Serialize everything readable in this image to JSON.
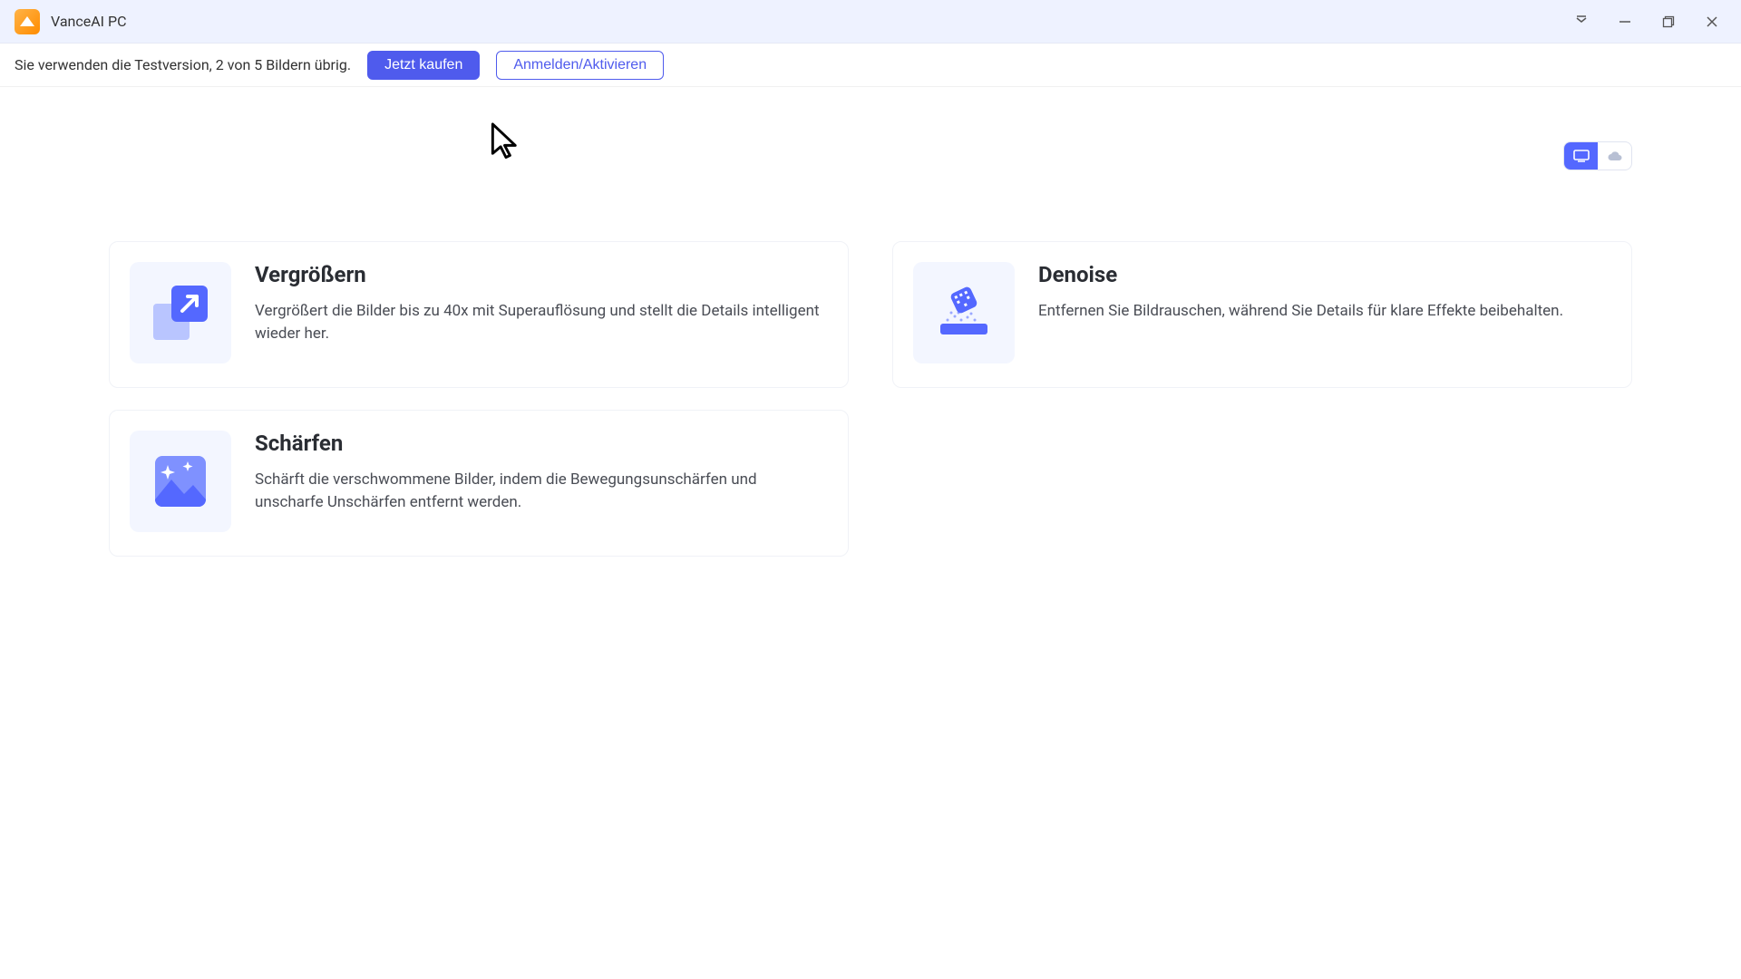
{
  "window": {
    "title": "VanceAI PC"
  },
  "trial": {
    "message": "Sie verwenden die Testversion, 2 von 5 Bildern übrig.",
    "buy_label": "Jetzt kaufen",
    "login_label": "Anmelden/Aktivieren"
  },
  "mode_toggle": {
    "local_icon": "monitor-icon",
    "cloud_icon": "cloud-icon",
    "active": "local"
  },
  "cards": [
    {
      "key": "enlarge",
      "title": "Vergrößern",
      "desc": "Vergrößert die Bilder bis zu 40x mit Superauflösung und stellt die Details intelligent wieder her.",
      "icon": "enlarge-icon"
    },
    {
      "key": "denoise",
      "title": "Denoise",
      "desc": "Entfernen Sie Bildrauschen, während Sie Details für klare Effekte beibehalten.",
      "icon": "denoise-icon"
    },
    {
      "key": "sharpen",
      "title": "Schärfen",
      "desc": "Schärft die verschwommene Bilder, indem die Bewegungsunschärfen und unscharfe Unschärfen entfernt werden.",
      "icon": "sharpen-icon"
    }
  ]
}
